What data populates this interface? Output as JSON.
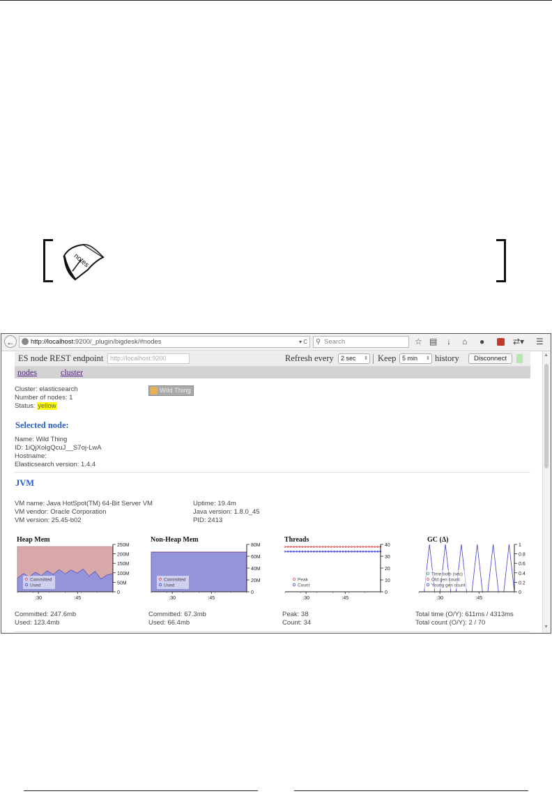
{
  "browser": {
    "url_host": "http://localhost",
    "url_rest": ":9200/_plugin/bigdesk/#nodes",
    "search_placeholder": "Search"
  },
  "es_bar": {
    "endpoint_label": "ES node REST endpoint",
    "endpoint_placeholder": "http://localhost:9200",
    "refresh_label": "Refresh every",
    "refresh_value": "2 sec",
    "keep_label": "Keep",
    "keep_value": "5 min",
    "history_label": "history",
    "disconnect_label": "Disconnect"
  },
  "nav": {
    "nodes": "nodes",
    "cluster": "cluster"
  },
  "cluster": {
    "name_line": "Cluster: elasticsearch",
    "nodes_line": "Number of nodes: 1",
    "status_label": "Status: ",
    "status_value": "yellow",
    "node_button": "Wild Thing"
  },
  "selected_node": {
    "heading": "Selected node:",
    "name": "Name: Wild Thing",
    "id": "ID: 1iQjXoIgQcuJ__S7oj-LwA",
    "hostname": "Hostname:",
    "es_version": "Elasticsearch version: 1.4.4"
  },
  "jvm": {
    "heading": "JVM",
    "vm_name": "VM name: Java HotSpot(TM) 64-Bit Server VM",
    "vm_vendor": "VM vendor: Oracle Corporation",
    "vm_version": "VM version: 25.45-b02",
    "uptime": "Uptime: 19.4m",
    "java_version": "Java version: 1.8.0_45",
    "pid": "PID: 2413"
  },
  "stats": {
    "heap_committed": "Committed: 247.6mb",
    "heap_used": "Used: 123.4mb",
    "nonheap_committed": "Committed: 67.3mb",
    "nonheap_used": "Used: 66.4mb",
    "threads_peak": "Peak: 38",
    "threads_count": "Count: 34",
    "gc_time": "Total time (O/Y): 611ms / 4313ms",
    "gc_count": "Total count (O/Y): 2 / 70"
  },
  "colors": {
    "committed_fill": "#d9a8a8",
    "used_fill": "#9494dc",
    "peak": "#e05050",
    "count": "#4040d0",
    "gc_line": "#3b3bd0"
  },
  "chart_data": [
    {
      "type": "area",
      "title": "Heap Mem",
      "x_ticks": [
        ":30",
        ":45"
      ],
      "y_ticks": [
        "0",
        "50M",
        "100M",
        "150M",
        "200M",
        "250M"
      ],
      "ylim": [
        0,
        260
      ],
      "series": [
        {
          "name": "Committed",
          "values": [
            248,
            248,
            248,
            248,
            248,
            248,
            248,
            248,
            248,
            248,
            248,
            248,
            248,
            248,
            248,
            248,
            248
          ]
        },
        {
          "name": "Used",
          "values": [
            75,
            100,
            82,
            108,
            88,
            115,
            95,
            122,
            98,
            120,
            102,
            125,
            86,
            112,
            70,
            92,
            100
          ]
        }
      ],
      "legend": "bottom-left"
    },
    {
      "type": "area",
      "title": "Non-Heap Mem",
      "x_ticks": [
        ":30",
        ":45"
      ],
      "y_ticks": [
        "0",
        "20M",
        "40M",
        "60M",
        "80M"
      ],
      "ylim": [
        0,
        80
      ],
      "series": [
        {
          "name": "Committed",
          "values": [
            67.3,
            67.3,
            67.3,
            67.3,
            67.3,
            67.3,
            67.3,
            67.3,
            67.3,
            67.3
          ]
        },
        {
          "name": "Used",
          "values": [
            66.4,
            66.4,
            66.4,
            66.4,
            66.4,
            66.4,
            66.4,
            66.4,
            66.4,
            66.4
          ]
        }
      ],
      "legend": "bottom-left"
    },
    {
      "type": "line",
      "title": "Threads",
      "x_ticks": [
        ":30",
        ":45"
      ],
      "y_ticks": [
        "0",
        "10",
        "20",
        "30",
        "40"
      ],
      "ylim": [
        0,
        40
      ],
      "series": [
        {
          "name": "Peak",
          "values": [
            38,
            38,
            38,
            38,
            38,
            38,
            38,
            38,
            38,
            38,
            38,
            38,
            38,
            38,
            38,
            38,
            38,
            38,
            38,
            38,
            38,
            38,
            38,
            38,
            38,
            38,
            38,
            38,
            38,
            38,
            38,
            38,
            38,
            38
          ]
        },
        {
          "name": "Count",
          "values": [
            34,
            34,
            34,
            34,
            34,
            34,
            34,
            34,
            34,
            34,
            34,
            34,
            34,
            34,
            34,
            34,
            34,
            34,
            34,
            34,
            34,
            34,
            34,
            34,
            34,
            34,
            34,
            34,
            34,
            34,
            34,
            34,
            34,
            34
          ]
        }
      ],
      "legend": "bottom-left"
    },
    {
      "type": "line",
      "title": "GC (Δ)",
      "x_ticks": [
        ":30",
        ":45"
      ],
      "y_ticks": [
        "0",
        "0.2",
        "0.4",
        "0.6",
        "0.8",
        "1"
      ],
      "ylim": [
        0,
        1
      ],
      "series": [
        {
          "name": "Time both (sec)",
          "values": []
        },
        {
          "name": "Old gen count",
          "values": []
        },
        {
          "name": "Young gen count",
          "values": [
            0,
            0,
            1,
            0,
            0,
            1,
            0,
            0,
            1,
            0,
            0,
            1,
            0,
            0,
            1,
            0,
            0,
            1,
            0
          ]
        }
      ],
      "legend": "bottom-left"
    }
  ]
}
